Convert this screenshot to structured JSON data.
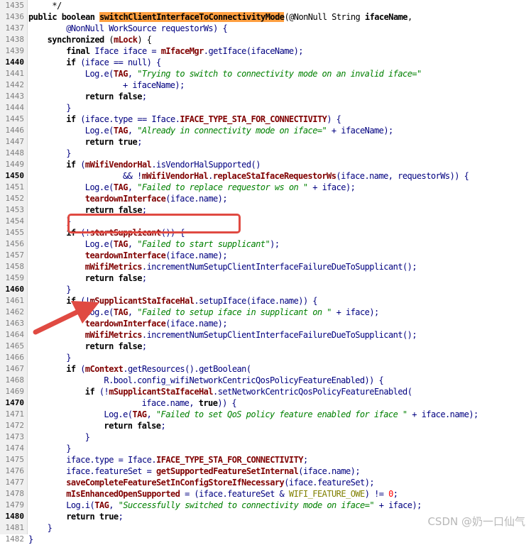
{
  "editor": {
    "rows": [
      {
        "line": "1435",
        "bold": false,
        "indent": 0,
        "tokens": [
          {
            "t": "p",
            "s": "     */"
          }
        ]
      },
      {
        "line": "1436",
        "bold": false,
        "indent": 0,
        "tokens": [
          {
            "t": "k",
            "s": "public boolean "
          },
          {
            "t": "hl",
            "s": "switchClientInterfaceToConnectivityMode"
          },
          {
            "t": "p",
            "s": "(@NonNull String "
          },
          {
            "t": "k",
            "s": "ifaceName"
          },
          {
            "t": "p",
            "s": ","
          }
        ]
      },
      {
        "line": "1437",
        "bold": false,
        "indent": 8,
        "tokens": [
          {
            "t": "v",
            "s": "@NonNull WorkSource requestorWs) {"
          }
        ]
      },
      {
        "line": "1438",
        "bold": false,
        "indent": 4,
        "tokens": [
          {
            "t": "k",
            "s": "synchronized "
          },
          {
            "t": "p",
            "s": "("
          },
          {
            "t": "f",
            "s": "mLock"
          },
          {
            "t": "p",
            "s": ") {"
          }
        ]
      },
      {
        "line": "1439",
        "bold": false,
        "indent": 8,
        "tokens": [
          {
            "t": "k",
            "s": "final "
          },
          {
            "t": "v",
            "s": "Iface iface = "
          },
          {
            "t": "f",
            "s": "mIfaceMgr"
          },
          {
            "t": "v",
            "s": ".getIface(ifaceName);"
          }
        ]
      },
      {
        "line": "1440",
        "bold": true,
        "indent": 8,
        "tokens": [
          {
            "t": "k",
            "s": "if "
          },
          {
            "t": "v",
            "s": "(iface == null) {"
          }
        ]
      },
      {
        "line": "1441",
        "bold": false,
        "indent": 12,
        "tokens": [
          {
            "t": "v",
            "s": "Log.e("
          },
          {
            "t": "f",
            "s": "TAG"
          },
          {
            "t": "v",
            "s": ", "
          },
          {
            "t": "s",
            "s": "\"Trying to switch to connectivity mode on an invalid iface=\""
          }
        ]
      },
      {
        "line": "1442",
        "bold": false,
        "indent": 20,
        "tokens": [
          {
            "t": "v",
            "s": "+ ifaceName);"
          }
        ]
      },
      {
        "line": "1443",
        "bold": false,
        "indent": 12,
        "tokens": [
          {
            "t": "k",
            "s": "return false"
          },
          {
            "t": "v",
            "s": ";"
          }
        ]
      },
      {
        "line": "1444",
        "bold": false,
        "indent": 8,
        "tokens": [
          {
            "t": "v",
            "s": "}"
          }
        ]
      },
      {
        "line": "1445",
        "bold": false,
        "indent": 8,
        "tokens": [
          {
            "t": "k",
            "s": "if "
          },
          {
            "t": "v",
            "s": "(iface.type == Iface."
          },
          {
            "t": "f",
            "s": "IFACE_TYPE_STA_FOR_CONNECTIVITY"
          },
          {
            "t": "v",
            "s": ") {"
          }
        ]
      },
      {
        "line": "1446",
        "bold": false,
        "indent": 12,
        "tokens": [
          {
            "t": "v",
            "s": "Log.e("
          },
          {
            "t": "f",
            "s": "TAG"
          },
          {
            "t": "v",
            "s": ", "
          },
          {
            "t": "s",
            "s": "\"Already in connectivity mode on iface=\""
          },
          {
            "t": "v",
            "s": " + ifaceName);"
          }
        ]
      },
      {
        "line": "1447",
        "bold": false,
        "indent": 12,
        "tokens": [
          {
            "t": "k",
            "s": "return true"
          },
          {
            "t": "v",
            "s": ";"
          }
        ]
      },
      {
        "line": "1448",
        "bold": false,
        "indent": 8,
        "tokens": [
          {
            "t": "v",
            "s": "}"
          }
        ]
      },
      {
        "line": "1449",
        "bold": false,
        "indent": 8,
        "tokens": [
          {
            "t": "k",
            "s": "if "
          },
          {
            "t": "v",
            "s": "("
          },
          {
            "t": "f",
            "s": "mWifiVendorHal"
          },
          {
            "t": "v",
            "s": ".isVendorHalSupported()"
          }
        ]
      },
      {
        "line": "1450",
        "bold": true,
        "indent": 20,
        "tokens": [
          {
            "t": "v",
            "s": "&& !"
          },
          {
            "t": "f",
            "s": "mWifiVendorHal"
          },
          {
            "t": "v",
            "s": "."
          },
          {
            "t": "f",
            "s": "replaceStaIfaceRequestorWs"
          },
          {
            "t": "v",
            "s": "(iface.name, requestorWs)) {"
          }
        ]
      },
      {
        "line": "1451",
        "bold": false,
        "indent": 12,
        "tokens": [
          {
            "t": "v",
            "s": "Log.e("
          },
          {
            "t": "f",
            "s": "TAG"
          },
          {
            "t": "v",
            "s": ", "
          },
          {
            "t": "s",
            "s": "\"Failed to replace requestor ws on \""
          },
          {
            "t": "v",
            "s": " + iface);"
          }
        ]
      },
      {
        "line": "1452",
        "bold": false,
        "indent": 12,
        "tokens": [
          {
            "t": "f",
            "s": "teardownInterface"
          },
          {
            "t": "v",
            "s": "(iface.name);"
          }
        ]
      },
      {
        "line": "1453",
        "bold": false,
        "indent": 12,
        "tokens": [
          {
            "t": "k",
            "s": "return false"
          },
          {
            "t": "v",
            "s": ";"
          }
        ]
      },
      {
        "line": "1454",
        "bold": false,
        "indent": 8,
        "tokens": [
          {
            "t": "v",
            "s": "}"
          }
        ]
      },
      {
        "line": "1455",
        "bold": false,
        "indent": 8,
        "tokens": [
          {
            "t": "k",
            "s": "if "
          },
          {
            "t": "v",
            "s": "(!"
          },
          {
            "t": "f",
            "s": "startSupplicant"
          },
          {
            "t": "v",
            "s": "()) {"
          }
        ]
      },
      {
        "line": "1456",
        "bold": false,
        "indent": 12,
        "tokens": [
          {
            "t": "v",
            "s": "Log.e("
          },
          {
            "t": "f",
            "s": "TAG"
          },
          {
            "t": "v",
            "s": ", "
          },
          {
            "t": "s",
            "s": "\"Failed to start supplicant\""
          },
          {
            "t": "v",
            "s": ");"
          }
        ]
      },
      {
        "line": "1457",
        "bold": false,
        "indent": 12,
        "tokens": [
          {
            "t": "f",
            "s": "teardownInterface"
          },
          {
            "t": "v",
            "s": "(iface.name);"
          }
        ]
      },
      {
        "line": "1458",
        "bold": false,
        "indent": 12,
        "tokens": [
          {
            "t": "f",
            "s": "mWifiMetrics"
          },
          {
            "t": "v",
            "s": ".incrementNumSetupClientInterfaceFailureDueToSupplicant();"
          }
        ]
      },
      {
        "line": "1459",
        "bold": false,
        "indent": 12,
        "tokens": [
          {
            "t": "k",
            "s": "return false"
          },
          {
            "t": "v",
            "s": ";"
          }
        ]
      },
      {
        "line": "1460",
        "bold": true,
        "indent": 8,
        "tokens": [
          {
            "t": "v",
            "s": "}"
          }
        ]
      },
      {
        "line": "1461",
        "bold": false,
        "indent": 8,
        "tokens": [
          {
            "t": "k",
            "s": "if "
          },
          {
            "t": "v",
            "s": "(!"
          },
          {
            "t": "f",
            "s": "mSupplicantStaIfaceHal"
          },
          {
            "t": "v",
            "s": ".setupIface(iface.name)) {"
          }
        ]
      },
      {
        "line": "1462",
        "bold": false,
        "indent": 12,
        "tokens": [
          {
            "t": "v",
            "s": "Log.e("
          },
          {
            "t": "f",
            "s": "TAG"
          },
          {
            "t": "v",
            "s": ", "
          },
          {
            "t": "s",
            "s": "\"Failed to setup iface in supplicant on \""
          },
          {
            "t": "v",
            "s": " + iface);"
          }
        ]
      },
      {
        "line": "1463",
        "bold": false,
        "indent": 12,
        "tokens": [
          {
            "t": "f",
            "s": "teardownInterface"
          },
          {
            "t": "v",
            "s": "(iface.name);"
          }
        ]
      },
      {
        "line": "1464",
        "bold": false,
        "indent": 12,
        "tokens": [
          {
            "t": "f",
            "s": "mWifiMetrics"
          },
          {
            "t": "v",
            "s": ".incrementNumSetupClientInterfaceFailureDueToSupplicant();"
          }
        ]
      },
      {
        "line": "1465",
        "bold": false,
        "indent": 12,
        "tokens": [
          {
            "t": "k",
            "s": "return false"
          },
          {
            "t": "v",
            "s": ";"
          }
        ]
      },
      {
        "line": "1466",
        "bold": false,
        "indent": 8,
        "tokens": [
          {
            "t": "v",
            "s": "}"
          }
        ]
      },
      {
        "line": "1467",
        "bold": false,
        "indent": 8,
        "tokens": [
          {
            "t": "k",
            "s": "if "
          },
          {
            "t": "v",
            "s": "("
          },
          {
            "t": "f",
            "s": "mContext"
          },
          {
            "t": "v",
            "s": ".getResources().getBoolean("
          }
        ]
      },
      {
        "line": "1468",
        "bold": false,
        "indent": 16,
        "tokens": [
          {
            "t": "v",
            "s": "R.bool.config_wifiNetworkCentricQosPolicyFeatureEnabled)) {"
          }
        ]
      },
      {
        "line": "1469",
        "bold": false,
        "indent": 12,
        "tokens": [
          {
            "t": "k",
            "s": "if "
          },
          {
            "t": "v",
            "s": "(!"
          },
          {
            "t": "f",
            "s": "mSupplicantStaIfaceHal"
          },
          {
            "t": "v",
            "s": ".setNetworkCentricQosPolicyFeatureEnabled("
          }
        ]
      },
      {
        "line": "1470",
        "bold": true,
        "indent": 24,
        "tokens": [
          {
            "t": "v",
            "s": "iface.name, "
          },
          {
            "t": "k",
            "s": "true"
          },
          {
            "t": "v",
            "s": ")) {"
          }
        ]
      },
      {
        "line": "1471",
        "bold": false,
        "indent": 16,
        "tokens": [
          {
            "t": "v",
            "s": "Log.e("
          },
          {
            "t": "f",
            "s": "TAG"
          },
          {
            "t": "v",
            "s": ", "
          },
          {
            "t": "s",
            "s": "\"Failed to set QoS policy feature enabled for iface \""
          },
          {
            "t": "v",
            "s": " + iface.name);"
          }
        ]
      },
      {
        "line": "1472",
        "bold": false,
        "indent": 16,
        "tokens": [
          {
            "t": "k",
            "s": "return false"
          },
          {
            "t": "v",
            "s": ";"
          }
        ]
      },
      {
        "line": "1473",
        "bold": false,
        "indent": 12,
        "tokens": [
          {
            "t": "v",
            "s": "}"
          }
        ]
      },
      {
        "line": "1474",
        "bold": false,
        "indent": 8,
        "tokens": [
          {
            "t": "v",
            "s": "}"
          }
        ]
      },
      {
        "line": "1475",
        "bold": false,
        "indent": 8,
        "tokens": [
          {
            "t": "v",
            "s": "iface.type = Iface."
          },
          {
            "t": "f",
            "s": "IFACE_TYPE_STA_FOR_CONNECTIVITY"
          },
          {
            "t": "v",
            "s": ";"
          }
        ]
      },
      {
        "line": "1476",
        "bold": false,
        "indent": 8,
        "tokens": [
          {
            "t": "v",
            "s": "iface.featureSet = "
          },
          {
            "t": "f",
            "s": "getSupportedFeatureSetInternal"
          },
          {
            "t": "v",
            "s": "(iface.name);"
          }
        ]
      },
      {
        "line": "1477",
        "bold": false,
        "indent": 8,
        "tokens": [
          {
            "t": "f",
            "s": "saveCompleteFeatureSetInConfigStoreIfNecessary"
          },
          {
            "t": "v",
            "s": "(iface.featureSet);"
          }
        ]
      },
      {
        "line": "1478",
        "bold": false,
        "indent": 8,
        "tokens": [
          {
            "t": "f",
            "s": "mIsEnhancedOpenSupported"
          },
          {
            "t": "v",
            "s": " = (iface.featureSet & "
          },
          {
            "t": "a",
            "s": "WIFI_FEATURE_OWE"
          },
          {
            "t": "v",
            "s": ") != "
          },
          {
            "t": "n",
            "s": "0"
          },
          {
            "t": "v",
            "s": ";"
          }
        ]
      },
      {
        "line": "1479",
        "bold": false,
        "indent": 8,
        "tokens": [
          {
            "t": "v",
            "s": "Log.i("
          },
          {
            "t": "f",
            "s": "TAG"
          },
          {
            "t": "v",
            "s": ", "
          },
          {
            "t": "s",
            "s": "\"Successfully switched to connectivity mode on iface=\""
          },
          {
            "t": "v",
            "s": " + iface);"
          }
        ]
      },
      {
        "line": "1480",
        "bold": true,
        "indent": 8,
        "tokens": [
          {
            "t": "k",
            "s": "return true"
          },
          {
            "t": "v",
            "s": ";"
          }
        ]
      },
      {
        "line": "1481",
        "bold": false,
        "indent": 4,
        "tokens": [
          {
            "t": "v",
            "s": "}"
          }
        ]
      },
      {
        "line": "1482",
        "bold": false,
        "indent": 0,
        "tokens": [
          {
            "t": "v",
            "s": "}"
          }
        ]
      }
    ]
  },
  "annotations": {
    "box_color": "#e04a42",
    "arrow_color": "#e04a42"
  },
  "watermark": "CSDN @奶一口仙气"
}
